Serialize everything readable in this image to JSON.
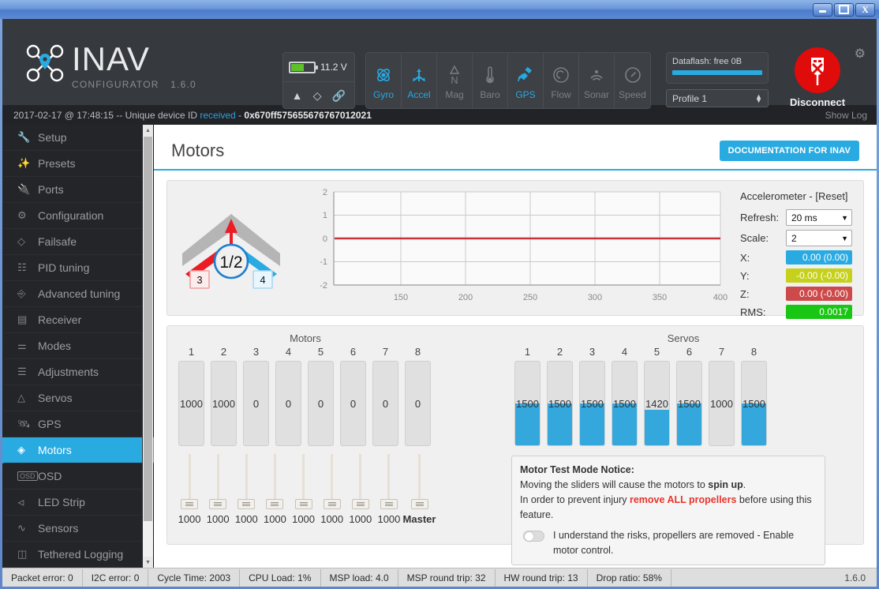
{
  "window": {
    "buttons": [
      {
        "name": "minimize",
        "glyph": ""
      },
      {
        "name": "restore",
        "glyph": ""
      },
      {
        "name": "close",
        "glyph": "X"
      }
    ]
  },
  "header": {
    "brand_name": "INAV",
    "brand_sub": "CONFIGURATOR",
    "version": "1.6.0",
    "battery": {
      "voltage": "11.2 V",
      "icons": [
        "warning-icon",
        "parachute-icon",
        "link-icon"
      ]
    },
    "sensors": [
      {
        "label": "Gyro",
        "icon": "gyro-icon",
        "active": true
      },
      {
        "label": "Accel",
        "icon": "accel-icon",
        "active": true
      },
      {
        "label": "Mag",
        "icon": "mag-icon",
        "active": false
      },
      {
        "label": "Baro",
        "icon": "baro-icon",
        "active": false
      },
      {
        "label": "GPS",
        "icon": "gps-icon",
        "active": true
      },
      {
        "label": "Flow",
        "icon": "flow-icon",
        "active": false
      },
      {
        "label": "Sonar",
        "icon": "sonar-icon",
        "active": false
      },
      {
        "label": "Speed",
        "icon": "speed-icon",
        "active": false
      }
    ],
    "dataflash_label": "Dataflash: free 0B",
    "dataflash_percent": 100,
    "profile": "Profile 1",
    "disconnect_label": "Disconnect",
    "accent_blue": "#29abe2",
    "disconnect_red": "#e00b0b"
  },
  "infobar": {
    "timestamp": "2017-02-17 @ 17:48:15 -- Unique device ID",
    "status": "received",
    "separator": "-",
    "device_id": "0x670ff575655676767012021",
    "show_log": "Show Log"
  },
  "sidebar": {
    "items": [
      {
        "label": "Setup",
        "icon": "wrench-icon",
        "active": false
      },
      {
        "label": "Presets",
        "icon": "wand-icon",
        "active": false
      },
      {
        "label": "Ports",
        "icon": "plug-icon",
        "active": false
      },
      {
        "label": "Configuration",
        "icon": "gear-icon",
        "active": false
      },
      {
        "label": "Failsafe",
        "icon": "parachute-icon",
        "active": false
      },
      {
        "label": "PID tuning",
        "icon": "sitemap-icon",
        "active": false
      },
      {
        "label": "Advanced tuning",
        "icon": "branch-icon",
        "active": false
      },
      {
        "label": "Receiver",
        "icon": "remote-icon",
        "active": false
      },
      {
        "label": "Modes",
        "icon": "sliders-icon",
        "active": false
      },
      {
        "label": "Adjustments",
        "icon": "equalizer-icon",
        "active": false
      },
      {
        "label": "Servos",
        "icon": "servo-icon",
        "active": false
      },
      {
        "label": "GPS",
        "icon": "satellite-icon",
        "active": false
      },
      {
        "label": "Motors",
        "icon": "motor-icon",
        "active": true
      },
      {
        "label": "OSD",
        "icon": "osd-icon",
        "active": false
      },
      {
        "label": "LED Strip",
        "icon": "led-icon",
        "active": false
      },
      {
        "label": "Sensors",
        "icon": "pulse-icon",
        "active": false
      },
      {
        "label": "Tethered Logging",
        "icon": "logging-icon",
        "active": false
      }
    ]
  },
  "page": {
    "title": "Motors",
    "doc_button": "DOCUMENTATION FOR INAV"
  },
  "mixer": {
    "type": "flying-wing",
    "center_label": "1/2",
    "left_label": "3",
    "right_label": "4",
    "arrow": "forward-arrow"
  },
  "chart_data": {
    "type": "line",
    "title": "",
    "xlabel": "",
    "ylabel": "",
    "xlim": [
      125,
      412
    ],
    "ylim": [
      -2,
      2
    ],
    "xticks": [
      150,
      200,
      250,
      300,
      350,
      400
    ],
    "yticks": [
      2,
      1,
      0,
      -1,
      -2
    ],
    "grid": true,
    "legend": "none",
    "series": [
      {
        "name": "accel-trace",
        "color": "#c9333b",
        "x": [
          125,
          412
        ],
        "values": [
          0,
          0
        ]
      }
    ]
  },
  "accelerometer": {
    "title": "Accelerometer - [Reset]",
    "refresh_label": "Refresh:",
    "refresh_value": "20 ms",
    "scale_label": "Scale:",
    "scale_value": "2",
    "rows": [
      {
        "label": "X:",
        "value": "0.00 (0.00)",
        "color": "#29abe2"
      },
      {
        "label": "Y:",
        "value": "-0.00 (-0.00)",
        "color": "#c5d11a"
      },
      {
        "label": "Z:",
        "value": "0.00 (-0.00)",
        "color": "#cc4a4a"
      },
      {
        "label": "RMS:",
        "value": "0.0017",
        "color": "#19c614"
      }
    ]
  },
  "motors": {
    "title": "Motors",
    "numbers": [
      "1",
      "2",
      "3",
      "4",
      "5",
      "6",
      "7",
      "8"
    ],
    "values": [
      "1000",
      "1000",
      "0",
      "0",
      "0",
      "0",
      "0",
      "0"
    ],
    "fills": [
      0,
      0,
      0,
      0,
      0,
      0,
      0,
      0
    ],
    "slider_values": [
      "1000",
      "1000",
      "1000",
      "1000",
      "1000",
      "1000",
      "1000",
      "1000"
    ],
    "master_label": "Master"
  },
  "servos": {
    "title": "Servos",
    "numbers": [
      "1",
      "2",
      "3",
      "4",
      "5",
      "6",
      "7",
      "8"
    ],
    "values": [
      "1500",
      "1500",
      "1500",
      "1500",
      "1420",
      "1500",
      "1000",
      "1500"
    ],
    "fills": [
      50,
      50,
      50,
      50,
      42,
      50,
      0,
      50
    ]
  },
  "notice": {
    "heading": "Motor Test Mode Notice:",
    "line1_a": "Moving the sliders will cause the motors to ",
    "line1_b": "spin up",
    "line1_c": ".",
    "line2_a": "In order to prevent injury ",
    "line2_b": "remove ALL propellers",
    "line2_c": " before using this feature.",
    "toggle_text": "I understand the risks, propellers are removed - Enable motor control.",
    "toggle_on": false
  },
  "statusbar": {
    "cells": [
      "Packet error: 0",
      "I2C error: 0",
      "Cycle Time: 2003",
      "CPU Load: 1%",
      "MSP load: 4.0",
      "MSP round trip: 32",
      "HW round trip: 13",
      "Drop ratio: 58%"
    ],
    "version": "1.6.0"
  }
}
